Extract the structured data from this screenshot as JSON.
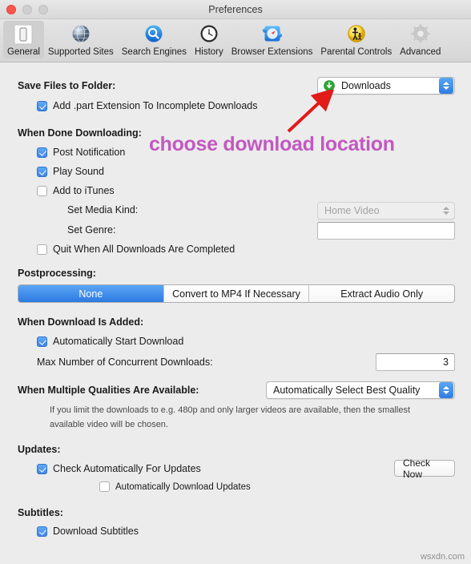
{
  "window": {
    "title": "Preferences",
    "traffic_lights": [
      "close",
      "minimize",
      "zoom"
    ]
  },
  "toolbar": {
    "items": [
      {
        "label": "General",
        "icon": "general-icon",
        "selected": true
      },
      {
        "label": "Supported Sites",
        "icon": "globe-icon",
        "selected": false
      },
      {
        "label": "Search Engines",
        "icon": "magnifier-icon",
        "selected": false
      },
      {
        "label": "History",
        "icon": "clock-icon",
        "selected": false
      },
      {
        "label": "Browser Extensions",
        "icon": "puzzle-compass-icon",
        "selected": false
      },
      {
        "label": "Parental Controls",
        "icon": "parental-controls-icon",
        "selected": false
      },
      {
        "label": "Advanced",
        "icon": "gear-icon",
        "selected": false
      }
    ]
  },
  "save_files": {
    "heading": "Save Files to Folder:",
    "folder_value": "Downloads",
    "folder_icon": "downloads-folder-icon",
    "add_part_extension": {
      "label": "Add .part Extension To Incomplete Downloads",
      "checked": true
    }
  },
  "when_done": {
    "heading": "When Done Downloading:",
    "post_notification": {
      "label": "Post Notification",
      "checked": true
    },
    "play_sound": {
      "label": "Play Sound",
      "checked": true
    },
    "add_to_itunes": {
      "label": "Add to iTunes",
      "checked": false
    },
    "set_media_kind": {
      "label": "Set Media Kind:",
      "value": "Home Video",
      "disabled": true
    },
    "set_genre": {
      "label": "Set Genre:",
      "value": "",
      "placeholder": ""
    },
    "quit_when_done": {
      "label": "Quit When All Downloads Are Completed",
      "checked": false
    }
  },
  "postprocessing": {
    "heading": "Postprocessing:",
    "options": [
      "None",
      "Convert to MP4 If Necessary",
      "Extract Audio Only"
    ],
    "selected_index": 0
  },
  "when_added": {
    "heading": "When Download Is Added:",
    "auto_start": {
      "label": "Automatically Start Download",
      "checked": true
    },
    "max_concurrent": {
      "label": "Max Number of Concurrent Downloads:",
      "value": "3"
    }
  },
  "qualities": {
    "heading": "When Multiple Qualities Are Available:",
    "value": "Automatically Select Best Quality",
    "help": "If you limit the downloads to e.g. 480p and only larger videos are available, then the smallest available video will be chosen."
  },
  "updates": {
    "heading": "Updates:",
    "check_automatically": {
      "label": "Check Automatically For Updates",
      "checked": true
    },
    "auto_download": {
      "label": "Automatically Download Updates",
      "checked": false
    },
    "check_now_button": "Check Now"
  },
  "subtitles": {
    "heading": "Subtitles:",
    "download_subtitles": {
      "label": "Download Subtitles",
      "checked": true
    }
  },
  "annotations": {
    "callout_text": "choose download location",
    "callout_color": "#c258c0",
    "arrow_color": "#e01b18"
  },
  "watermark": "wsxdn.com"
}
